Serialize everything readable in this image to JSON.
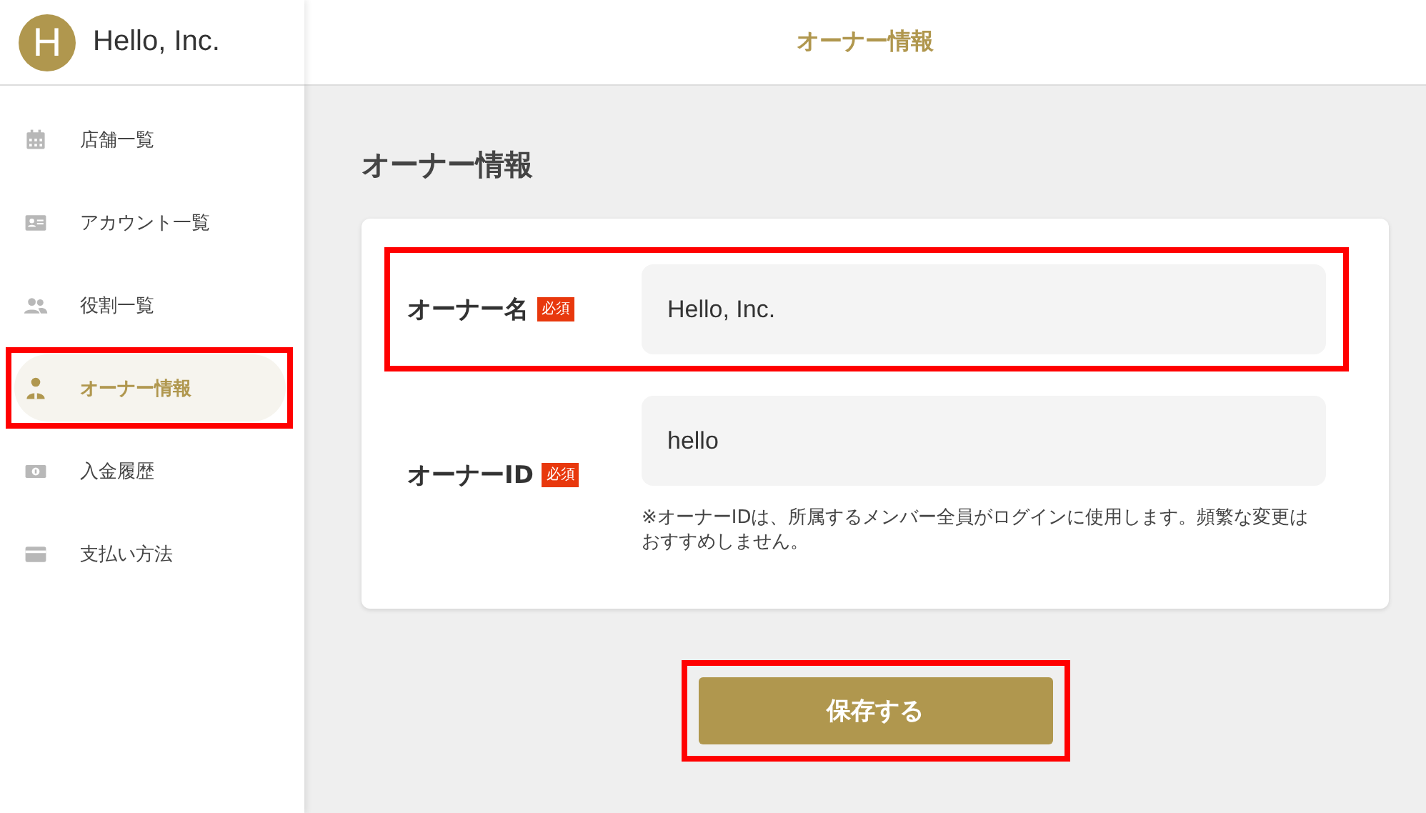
{
  "brand": {
    "initial": "H",
    "name": "Hello, Inc."
  },
  "sidebar": {
    "items": [
      {
        "label": "店舗一覧",
        "selected": false,
        "highlighted": false
      },
      {
        "label": "アカウント一覧",
        "selected": false,
        "highlighted": false
      },
      {
        "label": "役割一覧",
        "selected": false,
        "highlighted": false
      },
      {
        "label": "オーナー情報",
        "selected": true,
        "highlighted": true
      },
      {
        "label": "入金履歴",
        "selected": false,
        "highlighted": false
      },
      {
        "label": "支払い方法",
        "selected": false,
        "highlighted": false
      }
    ]
  },
  "header": {
    "title": "オーナー情報"
  },
  "page_title": "オーナー情報",
  "form": {
    "fields": [
      {
        "label": "オーナー名",
        "required_badge": "必須",
        "value": "Hello, Inc.",
        "highlighted": true
      },
      {
        "label": "オーナーID",
        "required_badge": "必須",
        "value": "hello",
        "help": "※オーナーIDは、所属するメンバー全員がログインに使用します。頻繁な変更はおすすめしません。",
        "highlighted": false
      }
    ]
  },
  "save_button": {
    "label": "保存する",
    "highlighted": true
  }
}
